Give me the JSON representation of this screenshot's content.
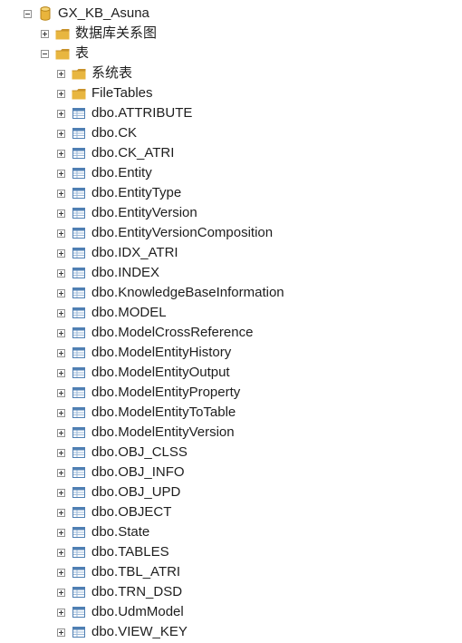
{
  "tree": {
    "root": {
      "label": "GX_KB_Asuna",
      "icon": "database-icon",
      "state": "expanded"
    },
    "diagrams": {
      "label": "数据库关系图",
      "icon": "folder-icon",
      "state": "collapsed"
    },
    "tables_folder": {
      "label": "表",
      "icon": "folder-icon",
      "state": "expanded"
    },
    "table_children": [
      {
        "label": "系统表",
        "icon": "folder-icon"
      },
      {
        "label": "FileTables",
        "icon": "folder-icon"
      },
      {
        "label": "dbo.ATTRIBUTE",
        "icon": "table-icon"
      },
      {
        "label": "dbo.CK",
        "icon": "table-icon"
      },
      {
        "label": "dbo.CK_ATRI",
        "icon": "table-icon"
      },
      {
        "label": "dbo.Entity",
        "icon": "table-icon"
      },
      {
        "label": "dbo.EntityType",
        "icon": "table-icon"
      },
      {
        "label": "dbo.EntityVersion",
        "icon": "table-icon"
      },
      {
        "label": "dbo.EntityVersionComposition",
        "icon": "table-icon"
      },
      {
        "label": "dbo.IDX_ATRI",
        "icon": "table-icon"
      },
      {
        "label": "dbo.INDEX",
        "icon": "table-icon"
      },
      {
        "label": "dbo.KnowledgeBaseInformation",
        "icon": "table-icon"
      },
      {
        "label": "dbo.MODEL",
        "icon": "table-icon"
      },
      {
        "label": "dbo.ModelCrossReference",
        "icon": "table-icon"
      },
      {
        "label": "dbo.ModelEntityHistory",
        "icon": "table-icon"
      },
      {
        "label": "dbo.ModelEntityOutput",
        "icon": "table-icon"
      },
      {
        "label": "dbo.ModelEntityProperty",
        "icon": "table-icon"
      },
      {
        "label": "dbo.ModelEntityToTable",
        "icon": "table-icon"
      },
      {
        "label": "dbo.ModelEntityVersion",
        "icon": "table-icon"
      },
      {
        "label": "dbo.OBJ_CLSS",
        "icon": "table-icon"
      },
      {
        "label": "dbo.OBJ_INFO",
        "icon": "table-icon"
      },
      {
        "label": "dbo.OBJ_UPD",
        "icon": "table-icon"
      },
      {
        "label": "dbo.OBJECT",
        "icon": "table-icon"
      },
      {
        "label": "dbo.State",
        "icon": "table-icon"
      },
      {
        "label": "dbo.TABLES",
        "icon": "table-icon"
      },
      {
        "label": "dbo.TBL_ATRI",
        "icon": "table-icon"
      },
      {
        "label": "dbo.TRN_DSD",
        "icon": "table-icon"
      },
      {
        "label": "dbo.UdmModel",
        "icon": "table-icon"
      },
      {
        "label": "dbo.VIEW_KEY",
        "icon": "table-icon"
      }
    ]
  },
  "colors": {
    "folder": "#e8b640",
    "folder_dark": "#c8922a",
    "database": "#e9b43c",
    "table_border": "#4f7fb3",
    "table_fill": "#d6e6f7"
  }
}
